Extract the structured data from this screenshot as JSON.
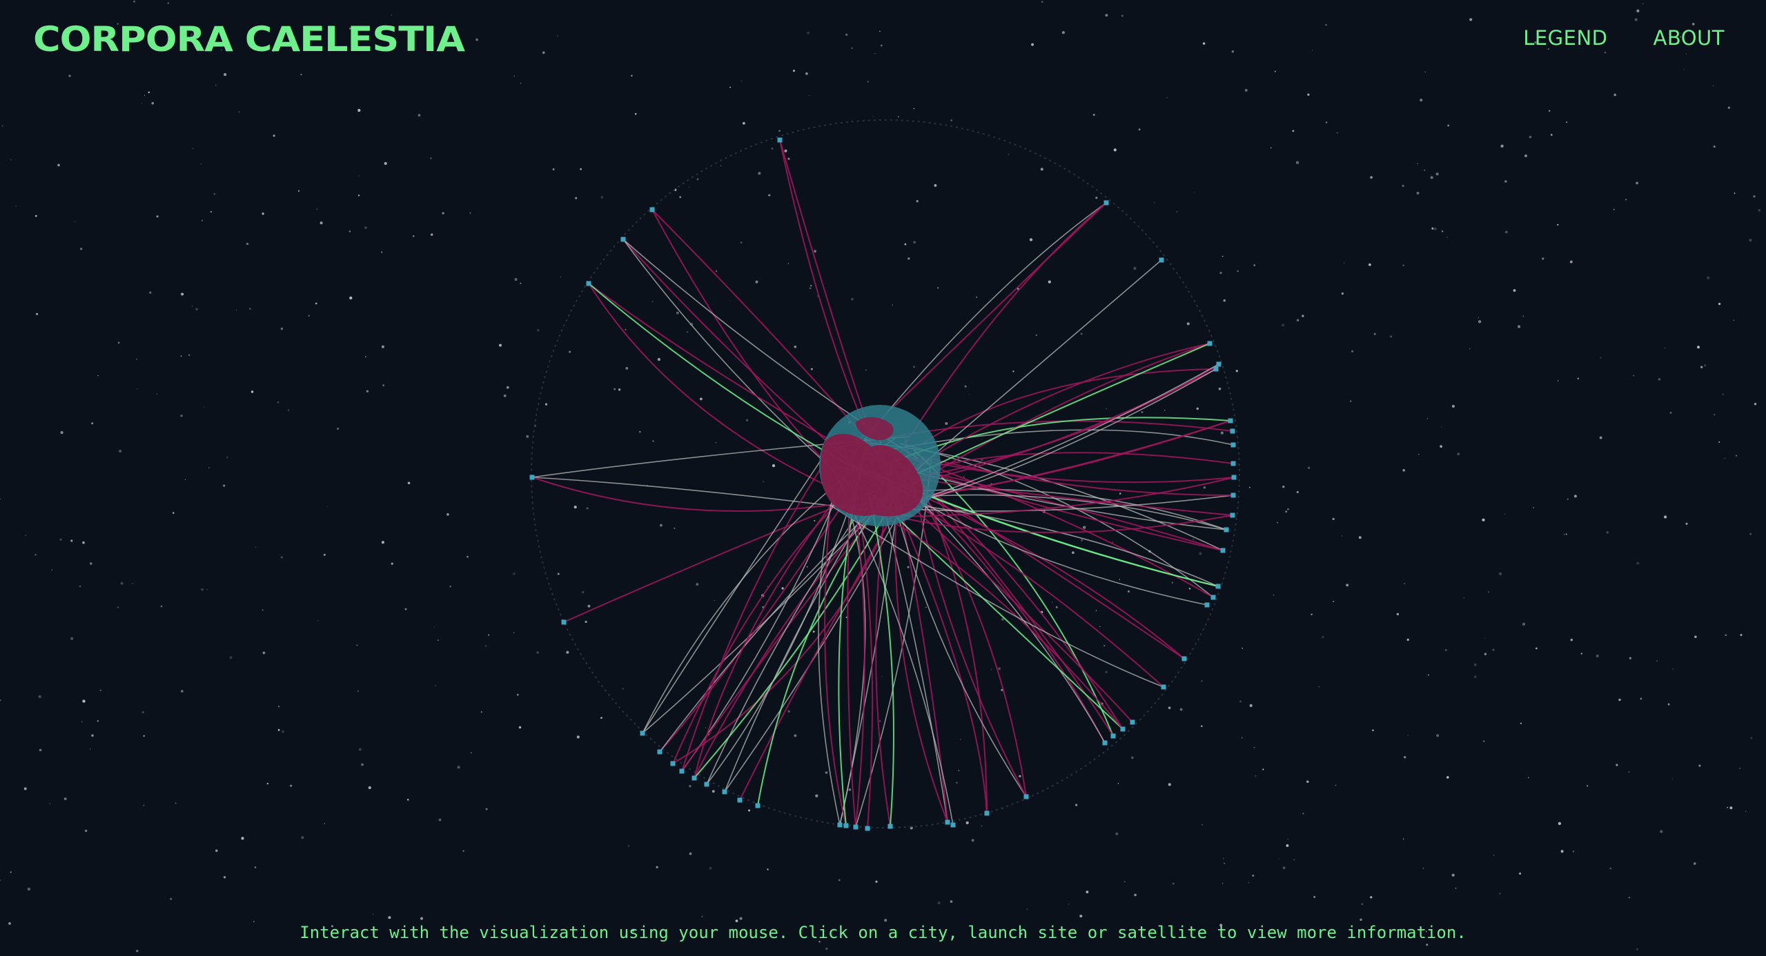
{
  "header": {
    "title": "CORPORA CAELESTIA",
    "nav": [
      {
        "label": "LEGEND"
      },
      {
        "label": "ABOUT"
      }
    ]
  },
  "footer": {
    "hint": "Interact with the visualization using your mouse. Click on a city, launch site or satellite to view more information."
  },
  "colors": {
    "background": "#0a111a",
    "accent": "#6ff08d",
    "orbit_pink": "#a3165f",
    "orbit_grey": "#b9b9b9",
    "orbit_green": "#6ff08d",
    "earth_ocean": "#2f7d8c",
    "earth_land": "#8a1845",
    "satellite_marker": "#3fa6c2"
  }
}
